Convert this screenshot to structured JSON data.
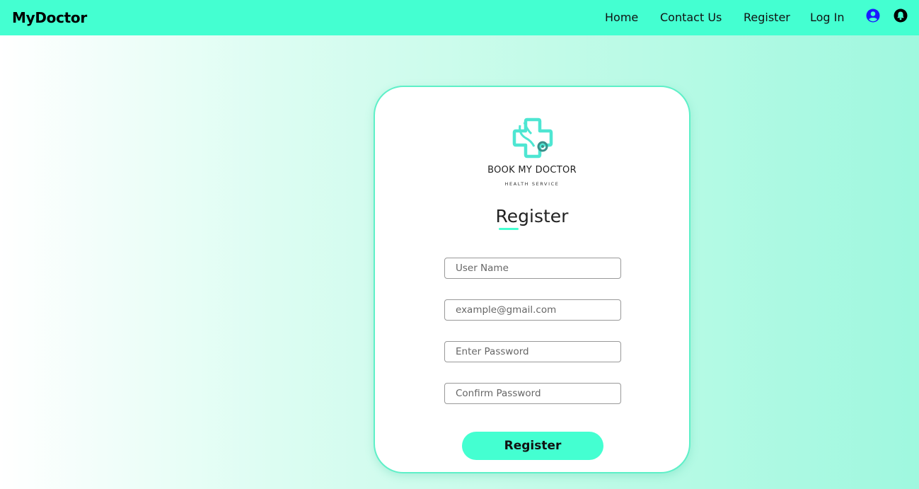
{
  "navbar": {
    "brand": "MyDoctor",
    "links": [
      "Home",
      "Contact Us",
      "Register",
      "Log In"
    ],
    "icons": [
      "user-circle-icon",
      "bell-icon"
    ],
    "background_color": "#44ffd1",
    "user_icon_color": "#1a1aff"
  },
  "card": {
    "logo": {
      "title": "BOOK MY DOCTOR",
      "subtitle": "HEALTH SERVICE",
      "color": "#4ee6d2"
    },
    "title": "Register",
    "fields": {
      "username_placeholder": "User Name",
      "email_placeholder": "example@gmail.com",
      "password_placeholder": "Enter Password",
      "confirm_placeholder": "Confirm Password"
    },
    "submit_label": "Register",
    "accent_color": "#44ffd1"
  }
}
